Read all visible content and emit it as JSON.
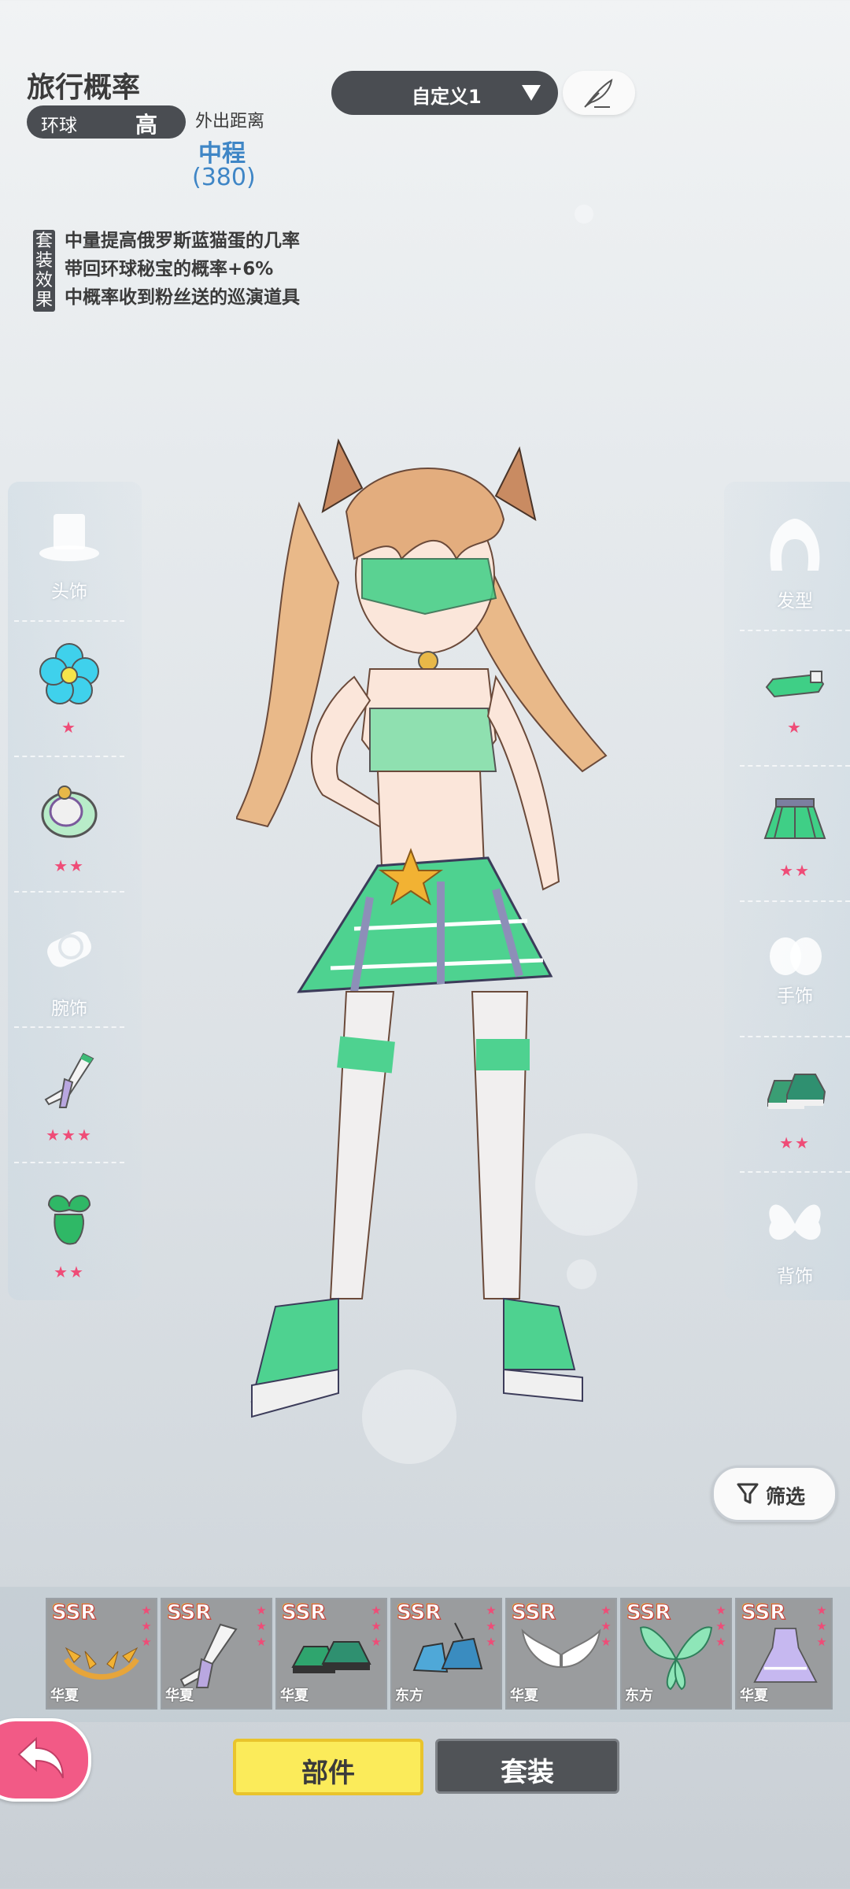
{
  "info": {
    "title": "旅行概率",
    "region_label": "环球",
    "region_value": "高",
    "distance_label": "外出距离",
    "distance_value": "中程",
    "distance_number": "(380)",
    "suit_tag": "套装效果",
    "effects": [
      "中量提高俄罗斯蓝猫蛋的几率",
      "带回环球秘宝的概率+6%",
      "中概率收到粉丝送的巡演道具"
    ]
  },
  "preset": {
    "label": "自定义1"
  },
  "left_slots": [
    {
      "label": "头饰",
      "stars": "",
      "icon": "top-hat-icon"
    },
    {
      "label": "",
      "stars": "★",
      "icon": "blue-flower-icon"
    },
    {
      "label": "",
      "stars": "★★",
      "icon": "collar-bell-icon"
    },
    {
      "label": "腕饰",
      "stars": "",
      "icon": "watch-icon"
    },
    {
      "label": "",
      "stars": "★★★",
      "icon": "stockings-icon"
    },
    {
      "label": "",
      "stars": "★★",
      "icon": "green-bow-icon"
    }
  ],
  "right_slots": [
    {
      "label": "发型",
      "stars": "",
      "icon": "hair-icon"
    },
    {
      "label": "",
      "stars": "★",
      "icon": "visor-icon"
    },
    {
      "label": "",
      "stars": "★★",
      "icon": "skirt-icon"
    },
    {
      "label": "手饰",
      "stars": "",
      "icon": "gloves-icon"
    },
    {
      "label": "",
      "stars": "★★",
      "icon": "sneakers-icon"
    },
    {
      "label": "背饰",
      "stars": "",
      "icon": "wings-icon"
    }
  ],
  "filter": {
    "label": "筛选"
  },
  "items": [
    {
      "rarity": "SSR",
      "region": "华夏",
      "icon": "laurel-crown-icon"
    },
    {
      "rarity": "SSR",
      "region": "华夏",
      "icon": "stocking-icon"
    },
    {
      "rarity": "SSR",
      "region": "华夏",
      "icon": "green-shoes-icon"
    },
    {
      "rarity": "SSR",
      "region": "东方",
      "icon": "blue-boots-icon"
    },
    {
      "rarity": "SSR",
      "region": "华夏",
      "icon": "white-wings-icon"
    },
    {
      "rarity": "SSR",
      "region": "东方",
      "icon": "green-fairy-wings-icon"
    },
    {
      "rarity": "SSR",
      "region": "华夏",
      "icon": "dress-icon"
    }
  ],
  "tabs": {
    "parts": "部件",
    "suits": "套装"
  },
  "colors": {
    "accent_blue": "#3f86c6",
    "star_pink": "#ef4c77",
    "tab_yellow": "#fbeb5a"
  }
}
